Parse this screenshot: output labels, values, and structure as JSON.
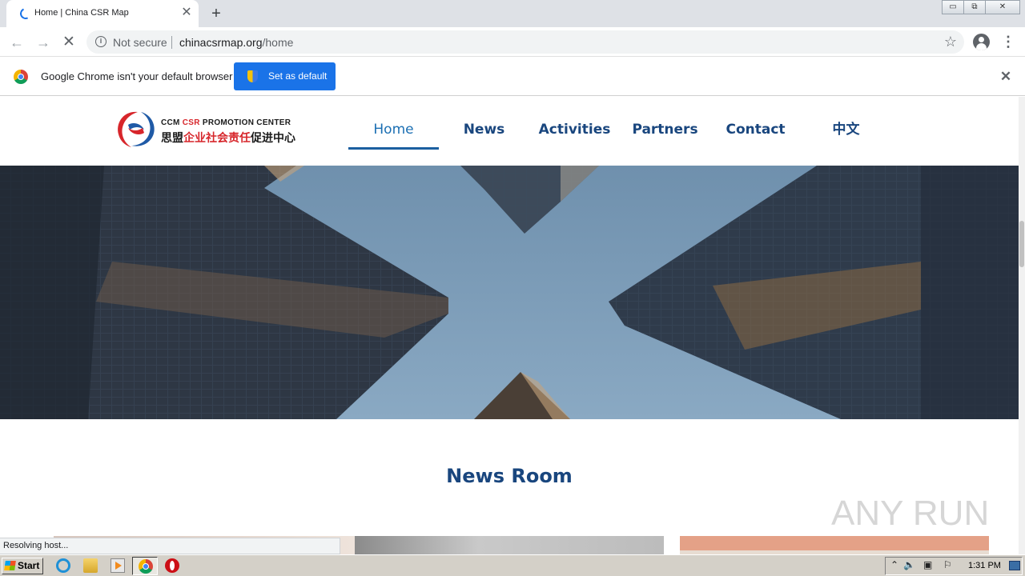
{
  "browser": {
    "tab_title": "Home | China CSR Map",
    "tab_close": "✕",
    "new_tab": "+",
    "window_controls": {
      "minimize": "▭",
      "restore": "⧉",
      "close": "✕"
    },
    "security_label": "Not secure",
    "url_domain": "chinacsrmap.org",
    "url_path": "/home",
    "bookmark_star": "☆",
    "menu_dots": "⋮",
    "back_glyph": "←",
    "forward_glyph": "→",
    "stop_glyph": "✕",
    "info_glyph": "i"
  },
  "infobar": {
    "message": "Google Chrome isn't your default browser",
    "set_default_label": "Set as default",
    "close_glyph": "✕"
  },
  "site": {
    "logo_en_prefix": "CCM ",
    "logo_en_accent": "CSR",
    "logo_en_suffix": " PROMOTION CENTER",
    "logo_cn_prefix": "思盟",
    "logo_cn_accent": "企业社会责任",
    "logo_cn_suffix": "促进中心",
    "nav": [
      "Home",
      "News",
      "Activities",
      "Partners",
      "Contact",
      "中文"
    ],
    "active_nav": "Home",
    "section_title": "News Room",
    "watermark": "ANY RUN"
  },
  "status_bar": {
    "text": "Resolving host..."
  },
  "taskbar": {
    "start_label": "Start",
    "tray_glyphs": [
      "⌃",
      "🔈",
      "▣",
      "⚐"
    ],
    "clock": "1:31 PM"
  },
  "colors": {
    "brand_navy": "#19467e",
    "brand_red": "#d7262b",
    "chrome_blue": "#1a73e8"
  }
}
